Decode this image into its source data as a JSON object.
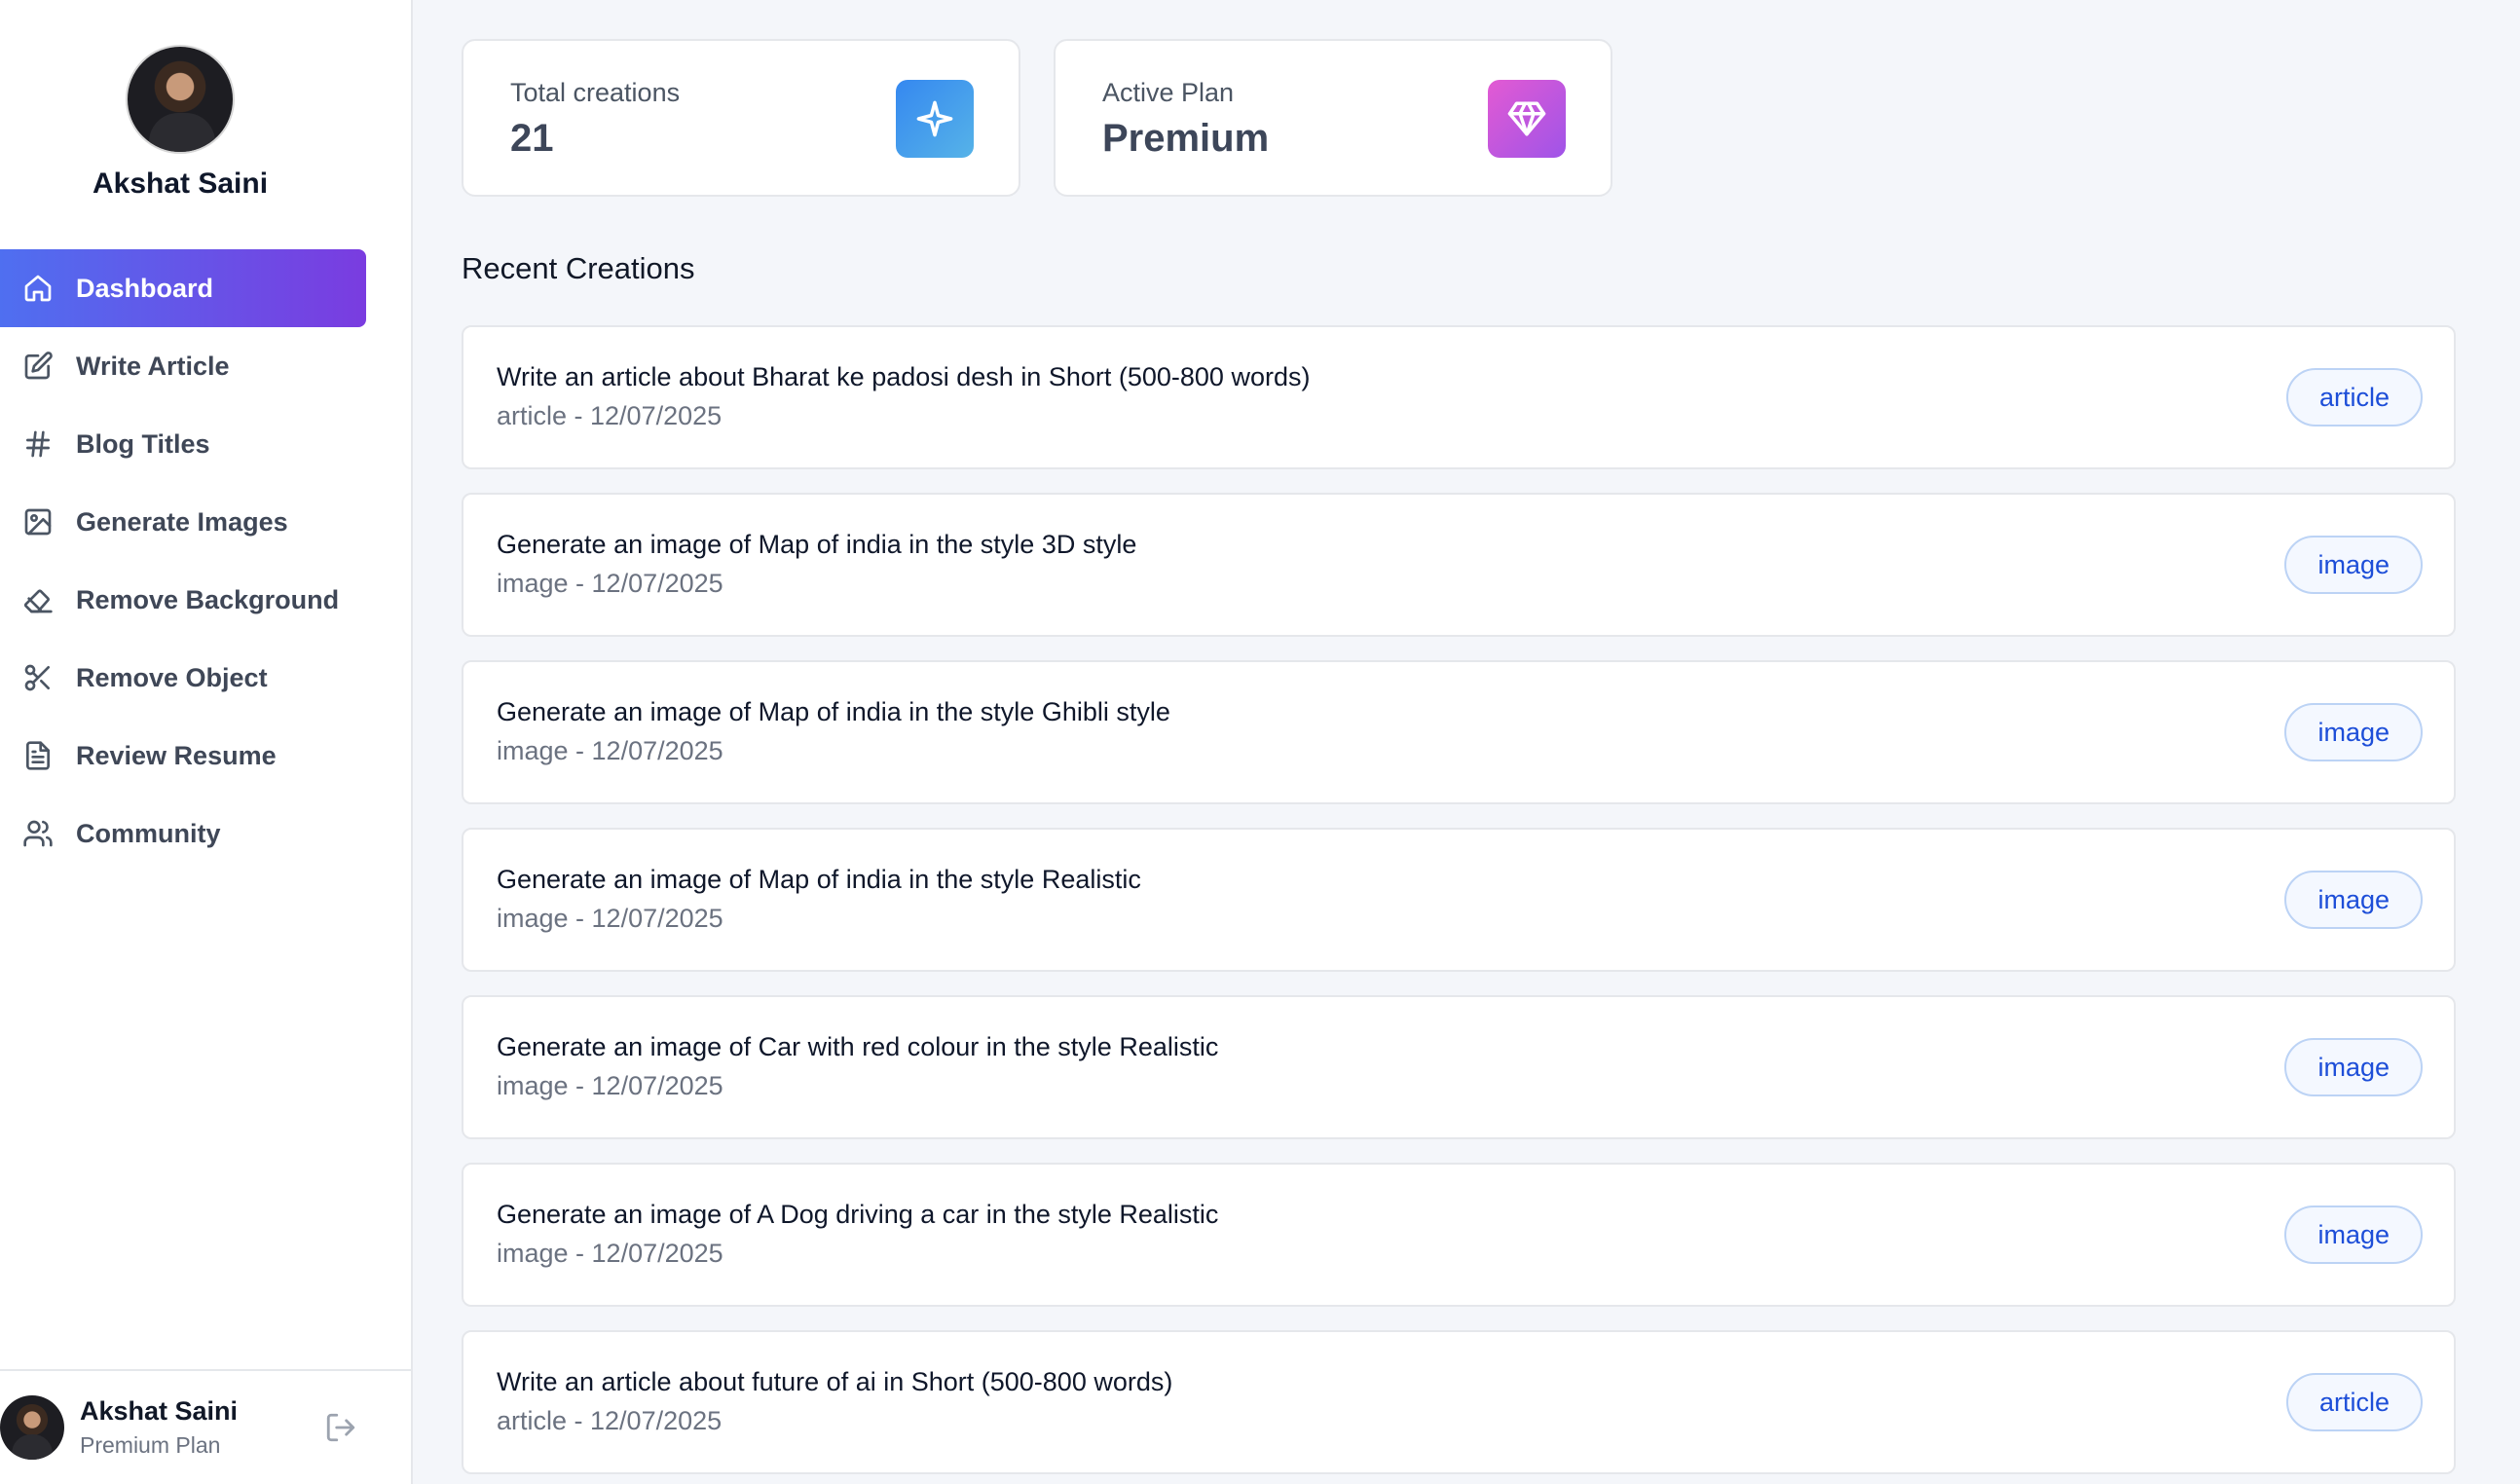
{
  "user": {
    "name": "Akshat Saini",
    "plan": "Premium Plan"
  },
  "nav": [
    {
      "label": "Dashboard",
      "icon": "home-icon",
      "active": true
    },
    {
      "label": "Write Article",
      "icon": "edit-icon"
    },
    {
      "label": "Blog Titles",
      "icon": "hash-icon"
    },
    {
      "label": "Generate Images",
      "icon": "image-icon"
    },
    {
      "label": "Remove Background",
      "icon": "eraser-icon"
    },
    {
      "label": "Remove Object",
      "icon": "scissors-icon"
    },
    {
      "label": "Review Resume",
      "icon": "file-text-icon"
    },
    {
      "label": "Community",
      "icon": "users-icon"
    }
  ],
  "stats": {
    "total": {
      "label": "Total creations",
      "value": "21",
      "icon": "sparkle-icon",
      "color": "#3b8ef0"
    },
    "plan": {
      "label": "Active Plan",
      "value": "Premium",
      "icon": "gem-icon",
      "color": "#d957d8"
    }
  },
  "recent": {
    "title": "Recent Creations",
    "items": [
      {
        "title": "Write an article about Bharat ke padosi desh in Short (500-800 words)",
        "meta": "article - 12/07/2025",
        "type": "article"
      },
      {
        "title": "Generate an image of Map of india in the style 3D style",
        "meta": "image - 12/07/2025",
        "type": "image"
      },
      {
        "title": "Generate an image of Map of india in the style Ghibli style",
        "meta": "image - 12/07/2025",
        "type": "image"
      },
      {
        "title": "Generate an image of Map of india in the style Realistic",
        "meta": "image - 12/07/2025",
        "type": "image"
      },
      {
        "title": "Generate an image of Car with red colour in the style Realistic",
        "meta": "image - 12/07/2025",
        "type": "image"
      },
      {
        "title": "Generate an image of A Dog driving a car in the style Realistic",
        "meta": "image - 12/07/2025",
        "type": "image"
      },
      {
        "title": "Write an article about future of ai in Short (500-800 words)",
        "meta": "article - 12/07/2025",
        "type": "article"
      }
    ]
  },
  "colors": {
    "accent_start": "#4f6ff0",
    "accent_end": "#7a3ce0",
    "badge_text": "#1d4ed8"
  }
}
